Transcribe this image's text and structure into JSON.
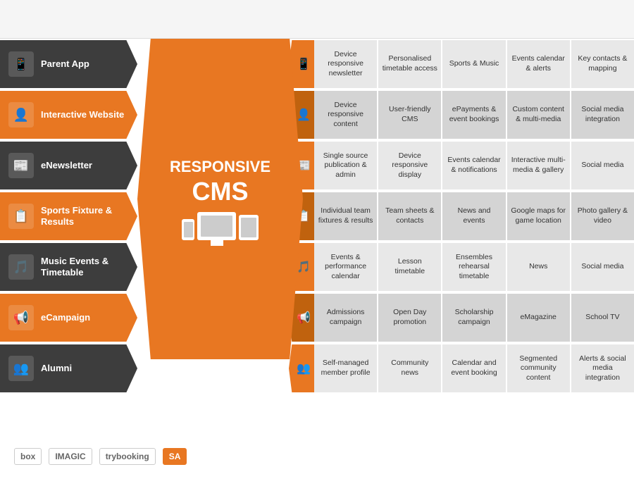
{
  "header": {
    "bg": "#f5f5f5"
  },
  "center": {
    "title": "RESPONSIVE",
    "subtitle": "CMS"
  },
  "left_items": [
    {
      "id": "parent-app",
      "label": "Parent App",
      "dark": true,
      "icon": "📱"
    },
    {
      "id": "interactive-website",
      "label": "Interactive Website",
      "dark": false,
      "icon": "👤"
    },
    {
      "id": "enewsletter",
      "label": "eNewsletter",
      "dark": true,
      "icon": "📰"
    },
    {
      "id": "sports-fixture",
      "label": "Sports Fixture & Results",
      "dark": false,
      "icon": "📋"
    },
    {
      "id": "music-events",
      "label": "Music Events & Timetable",
      "dark": true,
      "icon": "🎵"
    },
    {
      "id": "ecampaign",
      "label": "eCampaign",
      "dark": false,
      "icon": "📢"
    },
    {
      "id": "alumni",
      "label": "Alumni",
      "dark": true,
      "icon": "👥"
    }
  ],
  "right_rows": [
    {
      "icon": "📱",
      "cells": [
        "Device responsive newsletter",
        "Personalised timetable access",
        "Sports & Music",
        "Events calendar & alerts",
        "Key contacts & mapping"
      ]
    },
    {
      "icon": "👤",
      "cells": [
        "Device responsive content",
        "User-friendly CMS",
        "ePayments & event bookings",
        "Custom content & multi-media",
        "Social media integration"
      ]
    },
    {
      "icon": "📰",
      "cells": [
        "Single source publication & admin",
        "Device responsive display",
        "Events calendar & notifications",
        "Interactive multi-media & gallery",
        "Social media"
      ]
    },
    {
      "icon": "📋",
      "cells": [
        "Individual team fixtures & results",
        "Team sheets & contacts",
        "News and events",
        "Google maps for game location",
        "Photo gallery & video"
      ]
    },
    {
      "icon": "🎵",
      "cells": [
        "Events & performance calendar",
        "Lesson timetable",
        "Ensembles rehearsal timetable",
        "News",
        "Social media"
      ]
    },
    {
      "icon": "📢",
      "cells": [
        "Admissions campaign",
        "Open Day promotion",
        "Scholarship campaign",
        "eMagazine",
        "School TV"
      ]
    },
    {
      "icon": "👥",
      "cells": [
        "Self-managed member profile",
        "Community news",
        "Calendar and event booking",
        "Segmented community content",
        "Alerts & social media integration"
      ]
    }
  ],
  "logos": [
    "box",
    "IMAGIC",
    "trybooking"
  ],
  "watermark": ""
}
